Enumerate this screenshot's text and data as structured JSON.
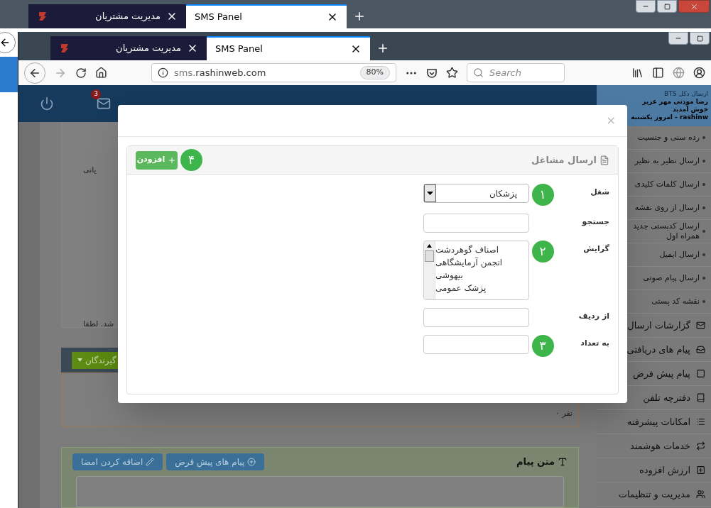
{
  "outer_window": {
    "tabs": [
      {
        "label": "SMS Panel",
        "selected": true
      },
      {
        "label": "مدیریت مشتریان",
        "selected": false
      }
    ]
  },
  "browser": {
    "tabs": [
      {
        "label": "SMS Panel",
        "selected": true
      },
      {
        "label": "مدیریت مشتریان",
        "selected": false
      }
    ],
    "address_host": "sms.",
    "address_domain": "rashinweb.com",
    "zoom": "80%",
    "search_placeholder": "Search"
  },
  "header": {
    "mail_badge": "3"
  },
  "sidebar": {
    "top_item": "ارسال دکل BTS",
    "greeting": "رضا موذنی مهر عزیز خوش آمدید",
    "date": "rashinw - امروز یکشنبه",
    "sub_items": [
      "رده سنی و جنسیت",
      "ارسال نظیر به نظیر",
      "ارسال کلمات کلیدی",
      "ارسال از روی نقشه",
      "ارسال کدپستی جدید همراه اول",
      "ارسال ایمیل",
      "ارسال پیام صوتی",
      "نقشه کد پستی"
    ],
    "items": [
      {
        "label": "گزارشات ارسال",
        "kind": "mail"
      },
      {
        "label": "پیام های دریافتی",
        "kind": "inbox"
      },
      {
        "label": "پیام پیش فرض",
        "kind": "square"
      },
      {
        "label": "دفترچه تلفن",
        "kind": "book"
      },
      {
        "label": "امکانات پیشرفته",
        "kind": "list"
      },
      {
        "label": "خدمات هوشمند",
        "kind": "repeat"
      },
      {
        "label": "ارزش افزوده",
        "kind": "plus"
      },
      {
        "label": "مدیریت و تنظیمات",
        "kind": "users"
      }
    ]
  },
  "main": {
    "fragments": [
      "یانی",
      "شد. لطفا"
    ],
    "recipients_button": "گیرندگان",
    "recipients_count": "۰ نفر",
    "message": {
      "title": "متن پیام",
      "buttons": [
        "پیام های پیش فرض",
        "اضافه کردن امضا"
      ]
    }
  },
  "modal": {
    "close": "×",
    "panel_title": "ارسال مشاغل",
    "add_button": "افزودن",
    "add_badge": "۴",
    "fields": [
      {
        "kind": "select",
        "label": "شغل",
        "value": "پزشکان",
        "badge": "۱"
      },
      {
        "kind": "text",
        "label": "جستجو"
      },
      {
        "kind": "list",
        "label": "گرایش",
        "options": [
          "اصناف گوهردشت",
          "انجمن آزمایشگاهی",
          "بیهوشی",
          "پزشک عمومی"
        ],
        "badge": "۲"
      },
      {
        "kind": "text",
        "label": "از ردیف"
      },
      {
        "kind": "text",
        "label": "به تعداد",
        "badge": "۳"
      }
    ]
  }
}
